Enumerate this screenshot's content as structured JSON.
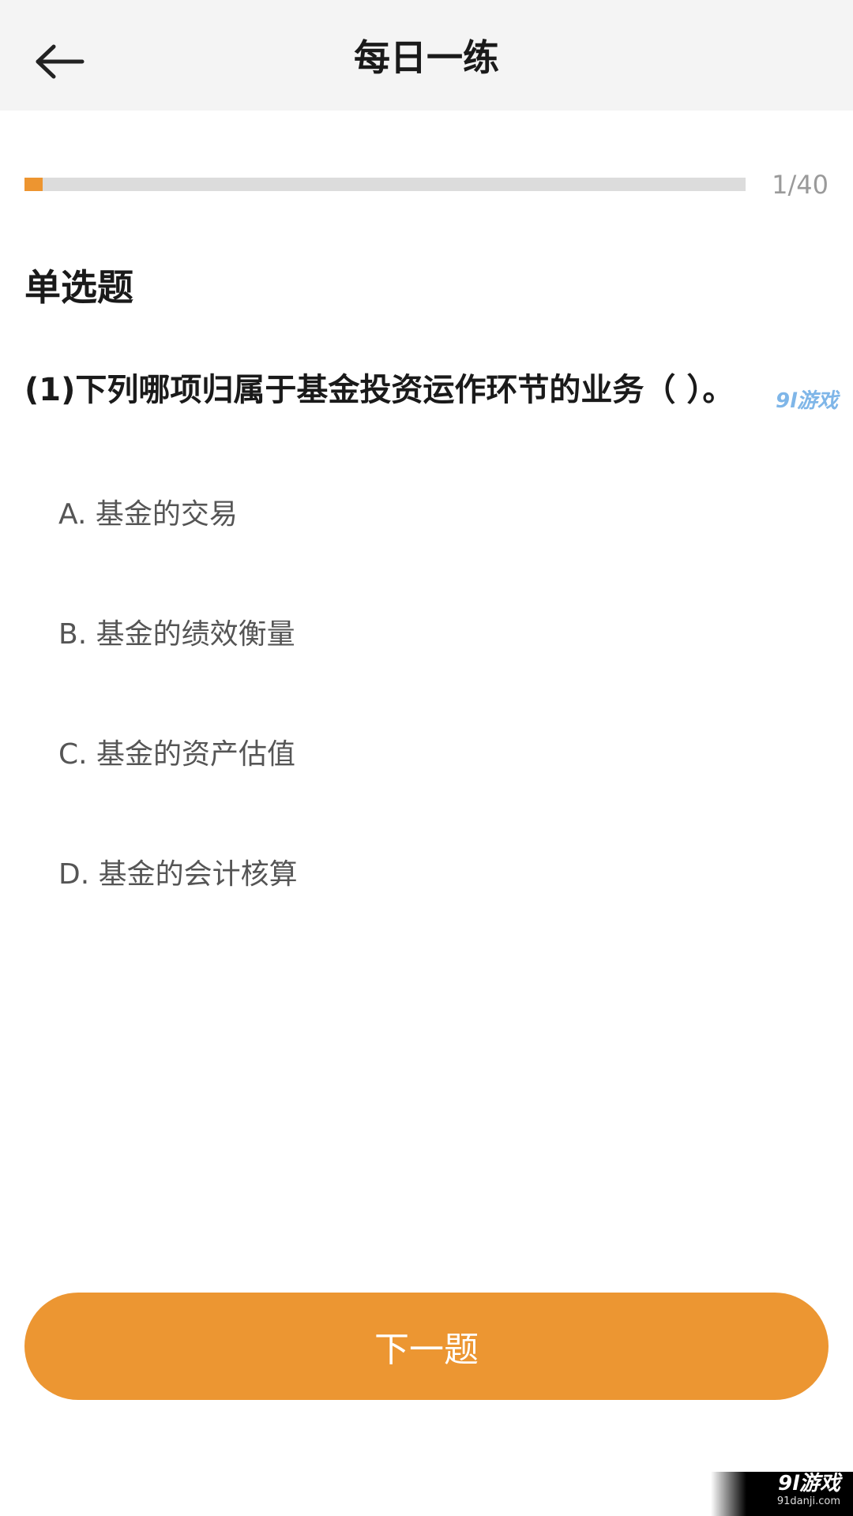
{
  "header": {
    "title": "每日一练",
    "back_icon": "arrow-left-icon"
  },
  "progress": {
    "current": 1,
    "total": 40,
    "label": "1/40",
    "fraction": 0.025,
    "fill_color": "#ed9530",
    "track_color": "#dcdcdc"
  },
  "question": {
    "type_label": "单选题",
    "text": "(1)下列哪项归属于基金投资运作环节的业务（    ）。",
    "options": [
      {
        "label": "A. 基金的交易"
      },
      {
        "label": "B. 基金的绩效衡量"
      },
      {
        "label": "C. 基金的资产估值"
      },
      {
        "label": "D. 基金的会计核算"
      }
    ]
  },
  "footer": {
    "next_label": "下一题",
    "button_color": "#ec9632"
  },
  "watermarks": {
    "mid": "9l游戏",
    "corner_main": "9l游戏",
    "corner_sub": "91danji.com"
  }
}
